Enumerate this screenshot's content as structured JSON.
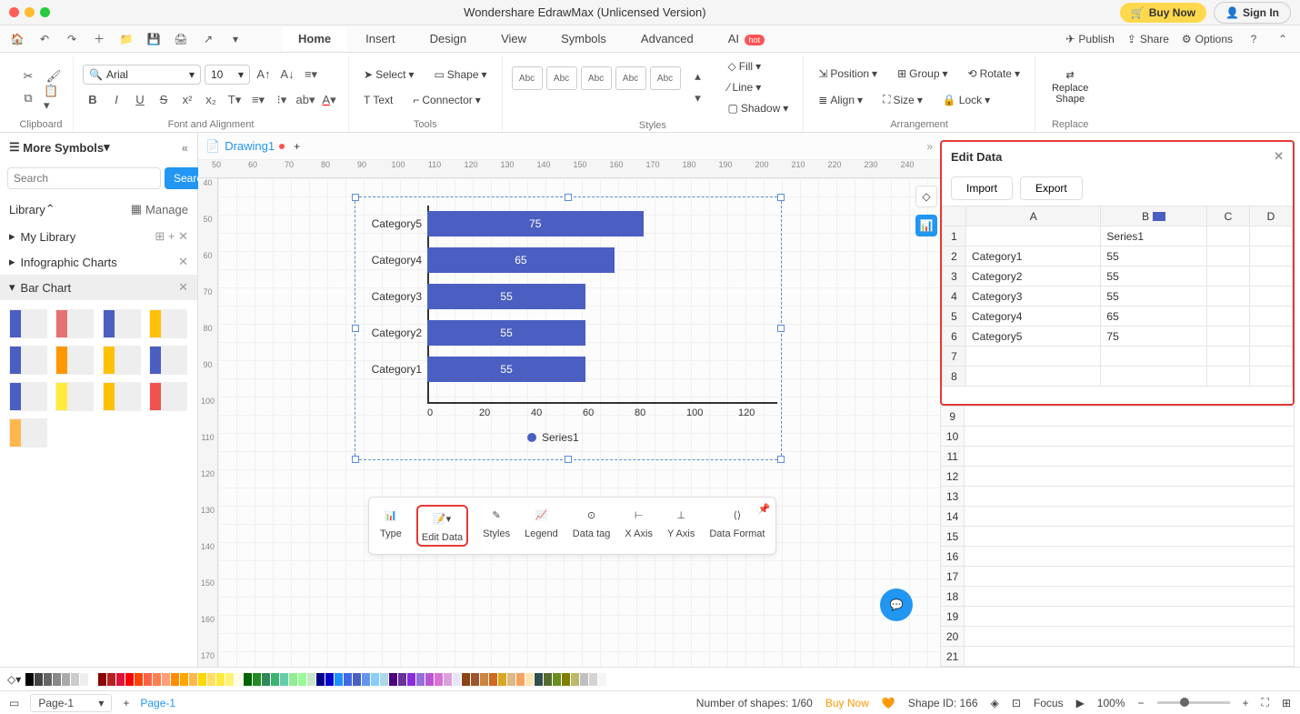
{
  "app_title": "Wondershare EdrawMax (Unlicensed Version)",
  "buy_now": "Buy Now",
  "sign_in": "Sign In",
  "tabs": {
    "home": "Home",
    "insert": "Insert",
    "design": "Design",
    "view": "View",
    "symbols": "Symbols",
    "advanced": "Advanced",
    "ai": "AI",
    "hot": "hot"
  },
  "top_right": {
    "publish": "Publish",
    "share": "Share",
    "options": "Options"
  },
  "ribbon": {
    "clipboard": "Clipboard",
    "font_alignment": "Font and Alignment",
    "font_name": "Arial",
    "font_size": "10",
    "tools": "Tools",
    "select": "Select",
    "shape": "Shape",
    "text": "Text",
    "connector": "Connector",
    "styles": "Styles",
    "style_label": "Abc",
    "fill": "Fill",
    "line": "Line",
    "shadow": "Shadow",
    "arrangement": "Arrangement",
    "position": "Position",
    "align": "Align",
    "group": "Group",
    "size": "Size",
    "rotate": "Rotate",
    "lock": "Lock",
    "replace": "Replace",
    "replace_shape": "Replace\nShape"
  },
  "sidebar": {
    "more_symbols": "More Symbols",
    "search_placeholder": "Search",
    "search_btn": "Search",
    "library": "Library",
    "manage": "Manage",
    "my_library": "My Library",
    "infographic": "Infographic Charts",
    "bar_chart": "Bar Chart"
  },
  "doc": {
    "name": "Drawing1"
  },
  "ruler_h": [
    "50",
    "60",
    "70",
    "80",
    "90",
    "100",
    "110",
    "120",
    "130",
    "140",
    "150",
    "160",
    "170",
    "180",
    "190",
    "200",
    "210",
    "220",
    "230",
    "240"
  ],
  "ruler_v": [
    "40",
    "50",
    "60",
    "70",
    "80",
    "90",
    "100",
    "110",
    "120",
    "130",
    "140",
    "150",
    "160",
    "170"
  ],
  "chart_data": {
    "type": "bar",
    "orientation": "horizontal",
    "categories": [
      "Category5",
      "Category4",
      "Category3",
      "Category2",
      "Category1"
    ],
    "values": [
      75,
      65,
      55,
      55,
      55
    ],
    "series_name": "Series1",
    "xlim": [
      0,
      120
    ],
    "xticks": [
      "0",
      "20",
      "40",
      "60",
      "80",
      "100",
      "120"
    ]
  },
  "float_toolbar": {
    "type": "Type",
    "edit_data": "Edit Data",
    "styles": "Styles",
    "legend": "Legend",
    "data_tag": "Data tag",
    "x_axis": "X Axis",
    "y_axis": "Y Axis",
    "data_format": "Data Format"
  },
  "edit_panel": {
    "title": "Edit Data",
    "import": "Import",
    "export": "Export",
    "cols": [
      "A",
      "B",
      "C",
      "D"
    ],
    "series_header": "Series1",
    "rows": [
      {
        "cat": "Category1",
        "val": "55"
      },
      {
        "cat": "Category2",
        "val": "55"
      },
      {
        "cat": "Category3",
        "val": "55"
      },
      {
        "cat": "Category4",
        "val": "65"
      },
      {
        "cat": "Category5",
        "val": "75"
      }
    ]
  },
  "status": {
    "page_sel": "Page-1",
    "page_tab": "Page-1",
    "shapes": "Number of shapes: 1/60",
    "buy_now": "Buy Now",
    "shape_id": "Shape ID: 166",
    "focus": "Focus",
    "zoom": "100%"
  }
}
